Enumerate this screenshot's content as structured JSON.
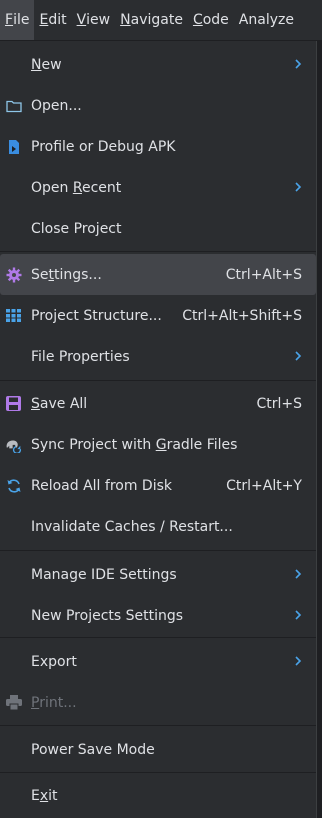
{
  "menubar": {
    "items": [
      {
        "pre": "",
        "m": "F",
        "post": "ile"
      },
      {
        "pre": "",
        "m": "E",
        "post": "dit"
      },
      {
        "pre": "",
        "m": "V",
        "post": "iew"
      },
      {
        "pre": "",
        "m": "N",
        "post": "avigate"
      },
      {
        "pre": "",
        "m": "C",
        "post": "ode"
      },
      {
        "pre": "",
        "m": "",
        "post": "Analyze"
      }
    ]
  },
  "file_menu": {
    "new": {
      "pre": "",
      "m": "N",
      "post": "ew"
    },
    "open": "Open...",
    "profile_debug_apk": "Profile or Debug APK",
    "open_recent": {
      "pre": "Open ",
      "m": "R",
      "post": "ecent"
    },
    "close_project": "Close Project",
    "settings": {
      "pre": "Se",
      "m": "t",
      "post": "tings...",
      "shortcut": "Ctrl+Alt+S"
    },
    "project_structure": {
      "label": "Project Structure...",
      "shortcut": "Ctrl+Alt+Shift+S"
    },
    "file_properties": "File Properties",
    "save_all": {
      "pre": "",
      "m": "S",
      "post": "ave All",
      "shortcut": "Ctrl+S"
    },
    "sync_project": {
      "pre": "Sync Project with ",
      "m": "G",
      "post": "radle Files"
    },
    "reload_all": {
      "label": "Reload All from Disk",
      "shortcut": "Ctrl+Alt+Y"
    },
    "invalidate_caches": "Invalidate Caches / Restart...",
    "manage_ide_settings": "Manage IDE Settings",
    "new_projects_settings": "New Projects Settings",
    "export": "Export",
    "print": {
      "pre": "",
      "m": "P",
      "post": "rint..."
    },
    "power_save_mode": "Power Save Mode",
    "exit": {
      "pre": "E",
      "m": "x",
      "post": "it"
    }
  },
  "colors": {
    "menu_bg": "#2b2d30",
    "selected_bg": "#43454a",
    "chevron": "#4aa3e8",
    "folder_icon": "#8ec6e8",
    "apk_icon": "#3a8de0",
    "settings_icon": "#b07ae8",
    "structure_icon": "#4aa3e8",
    "save_icon": "#b07ae8",
    "reload_icon": "#4aa3e8",
    "disabled_text": "#6f737a"
  },
  "icons": {
    "open": "folder-icon",
    "profile": "apk-file-icon",
    "settings": "gear-icon",
    "structure": "grid-icon",
    "save": "floppy-disk-icon",
    "sync": "elephant-sync-icon",
    "reload": "reload-icon",
    "print": "printer-icon"
  }
}
